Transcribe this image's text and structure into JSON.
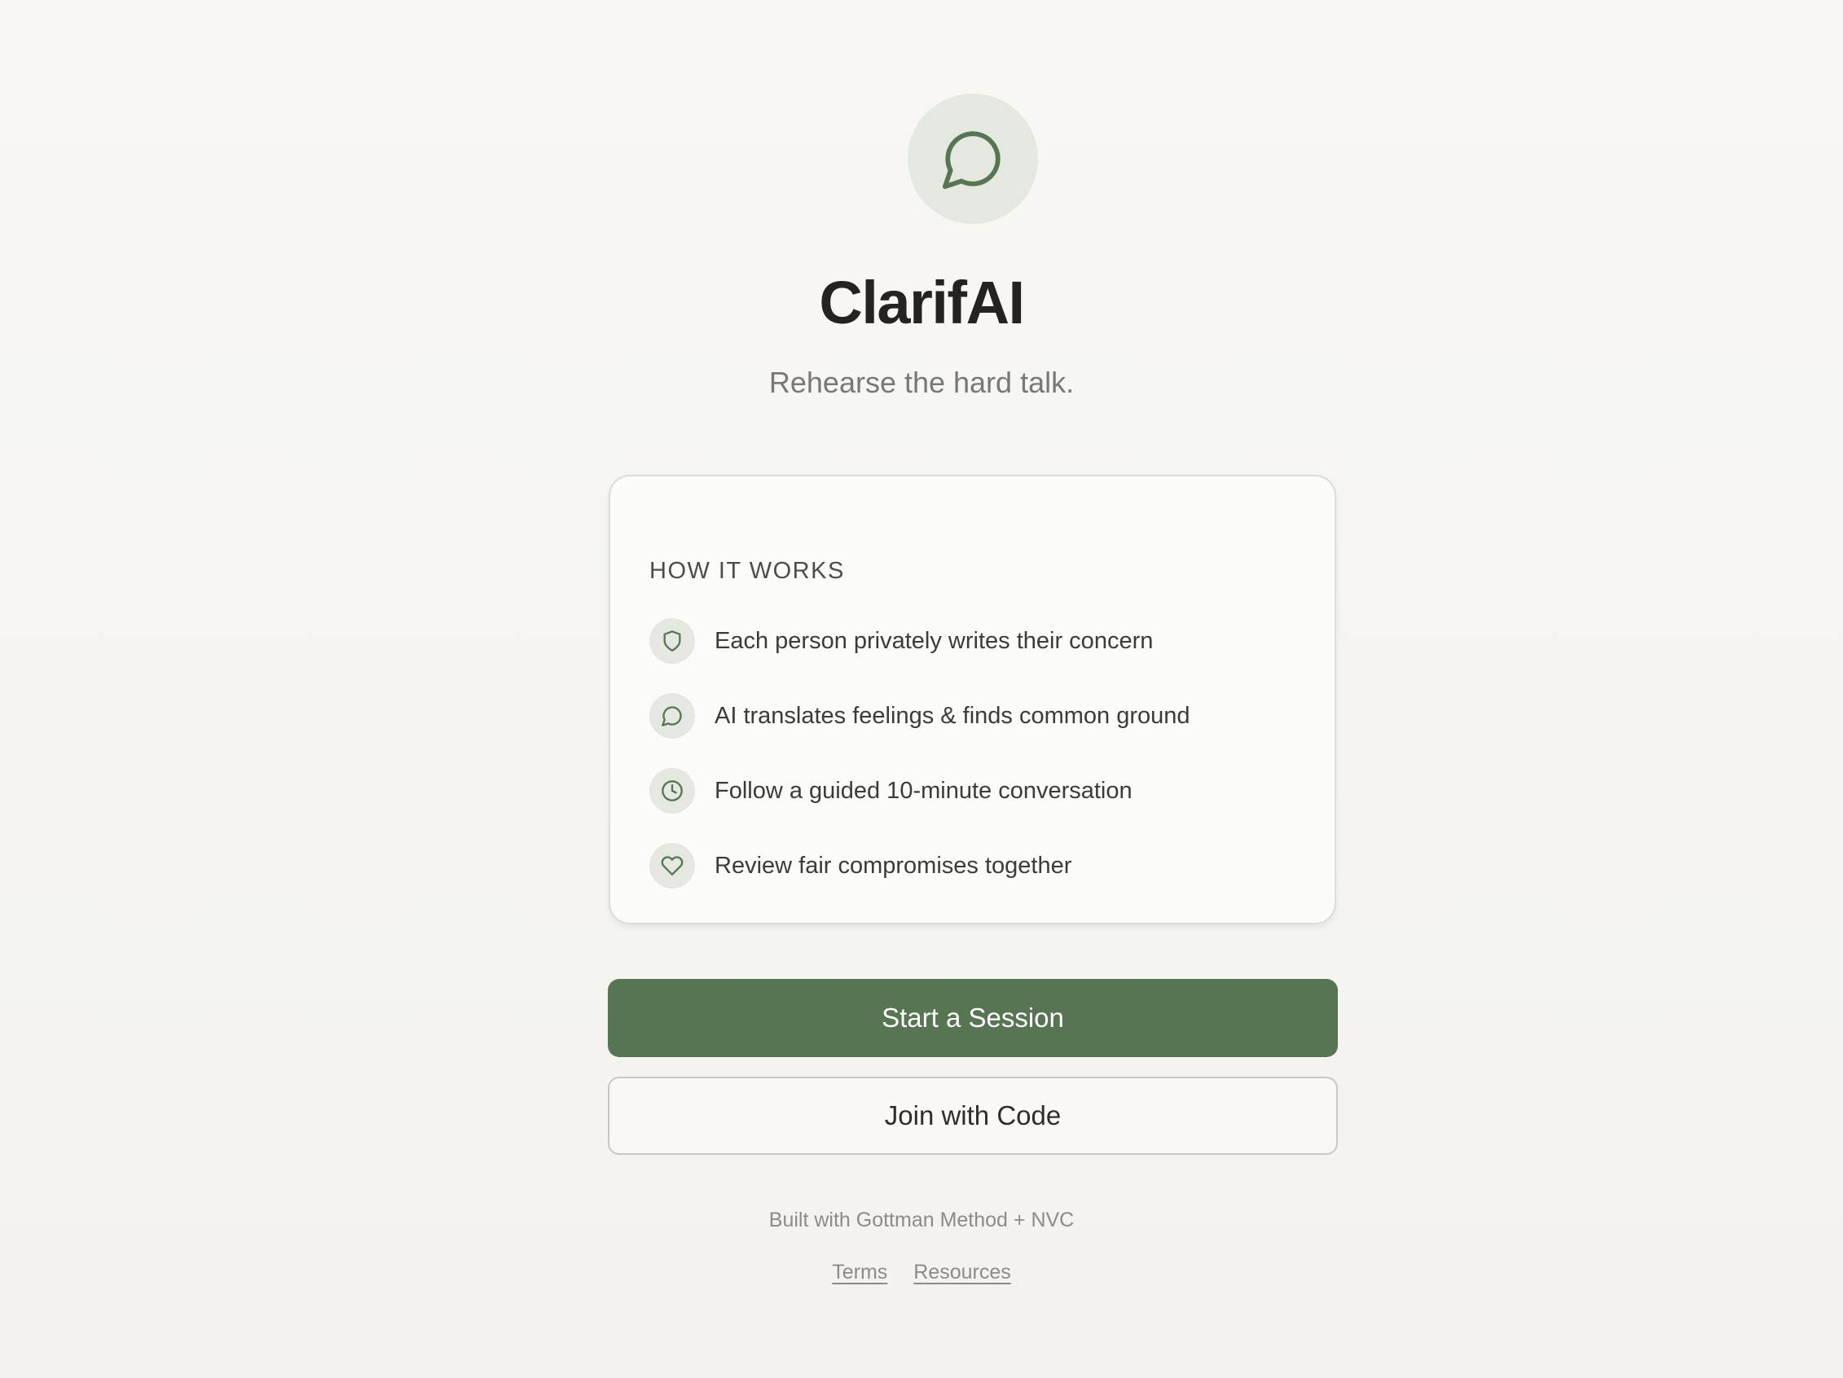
{
  "app": {
    "title": "ClarifAI",
    "tagline": "Rehearse the hard talk.",
    "logo_icon": "chat-bubble-icon"
  },
  "how_it_works": {
    "heading": "HOW IT WORKS",
    "steps": [
      {
        "icon": "shield-icon",
        "text": "Each person privately writes their concern"
      },
      {
        "icon": "chat-bubble-icon",
        "text": "AI translates feelings & finds common ground"
      },
      {
        "icon": "clock-icon",
        "text": "Follow a guided 10-minute conversation"
      },
      {
        "icon": "heart-icon",
        "text": "Review fair compromises together"
      }
    ]
  },
  "actions": {
    "start_label": "Start a Session",
    "join_label": "Join with Code"
  },
  "footer": {
    "note": "Built with Gottman Method + NVC",
    "links": [
      "Terms",
      "Resources"
    ]
  },
  "colors": {
    "accent": "#587553",
    "icon_bg": "#e4e8e1",
    "background": "#f6f5f2"
  }
}
